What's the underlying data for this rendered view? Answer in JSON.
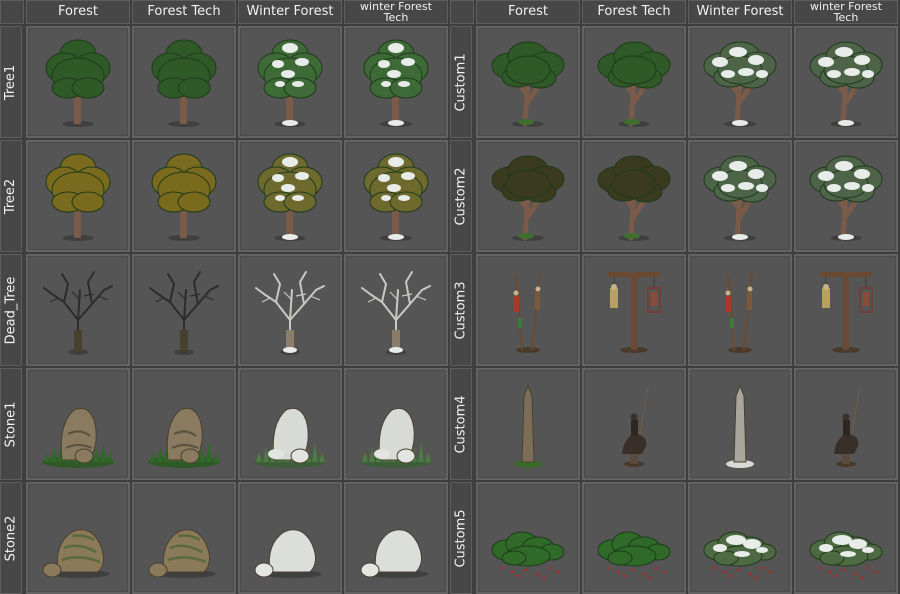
{
  "left_panel": {
    "columns": [
      "Forest",
      "Forest Tech",
      "Winter Forest",
      "winter Forest\nTech"
    ],
    "rows": [
      "Tree1",
      "Tree2",
      "Dead_Tree",
      "Stone1",
      "Stone2"
    ]
  },
  "right_panel": {
    "columns": [
      "Forest",
      "Forest Tech",
      "Winter Forest",
      "winter Forest\nTech"
    ],
    "rows": [
      "Custom1",
      "Custom2",
      "Custom3",
      "Custom4",
      "Custom5"
    ]
  },
  "sprites": {
    "left": [
      [
        "tree-green-icon",
        "tree-green-icon",
        "tree-snowy-icon",
        "tree-snowy-icon"
      ],
      [
        "tree-autumn-icon",
        "tree-autumn-icon",
        "tree-autumn-snowy-icon",
        "tree-autumn-snowy-icon"
      ],
      [
        "dead-tree-icon",
        "dead-tree-icon",
        "dead-tree-snowy-icon",
        "dead-tree-snowy-icon"
      ],
      [
        "stone-mossy-icon",
        "stone-mossy-icon",
        "stone-snowy-icon",
        "stone-snowy-icon"
      ],
      [
        "boulder-icon",
        "boulder-icon",
        "boulder-snowy-icon",
        "boulder-snowy-icon"
      ]
    ],
    "right": [
      [
        "oak-green-icon",
        "oak-green-icon",
        "oak-snowy-icon",
        "oak-snowy-icon"
      ],
      [
        "oak-dark-icon",
        "oak-dark-icon",
        "oak-snowy-icon",
        "oak-snowy-icon"
      ],
      [
        "spear-corpses-icon",
        "gallows-icon",
        "spear-corpses-icon",
        "gallows-icon"
      ],
      [
        "obelisk-icon",
        "knight-statue-icon",
        "obelisk-snowy-icon",
        "knight-statue-icon"
      ],
      [
        "bush-icon",
        "bush-icon",
        "bush-snowy-icon",
        "bush-snowy-icon"
      ]
    ]
  },
  "colors": {
    "background": "#3e3e3e",
    "header": "#474747",
    "cell": "#555555",
    "cell_border": "#636363",
    "foliage_green": "#2f5a28",
    "foliage_autumn": "#7a6a1e",
    "snow": "#e8ece8",
    "trunk": "#7a5a48",
    "stone": "#8a7a60"
  }
}
